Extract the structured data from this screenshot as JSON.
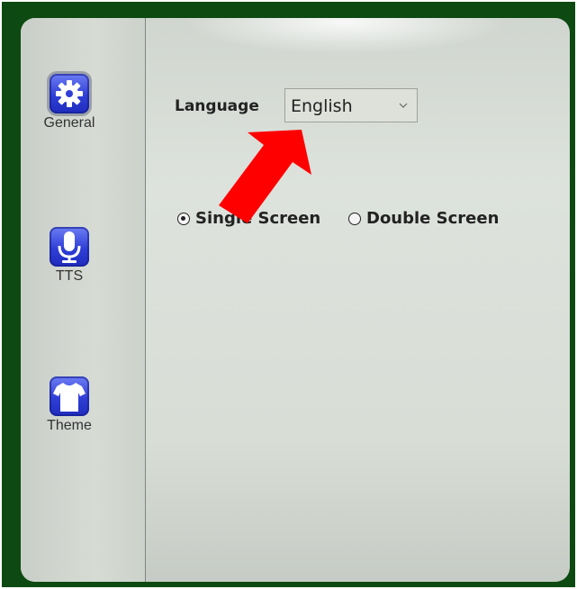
{
  "sidebar": {
    "items": [
      {
        "label": "General",
        "icon": "gear-icon",
        "selected": true
      },
      {
        "label": "TTS",
        "icon": "microphone-icon",
        "selected": false
      },
      {
        "label": "Theme",
        "icon": "tshirt-icon",
        "selected": false
      }
    ]
  },
  "general": {
    "language_label": "Language",
    "language_value": "English",
    "screen_options": [
      {
        "label": "Single Screen",
        "checked": true
      },
      {
        "label": "Double Screen",
        "checked": false
      }
    ]
  },
  "annotation": {
    "type": "arrow",
    "color": "#ff0000",
    "points_to": "language-select"
  },
  "colors": {
    "frame": "#0d4a12",
    "icon_blue": "#2f3fd6",
    "panel": "#d8ddd6"
  }
}
